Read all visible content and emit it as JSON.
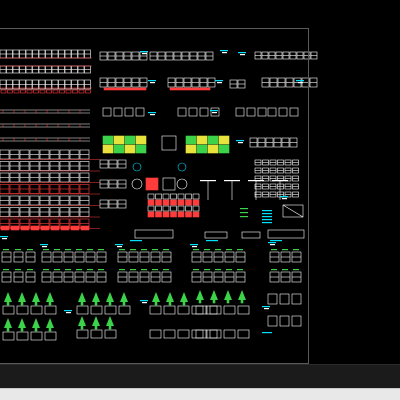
{
  "app": {
    "view": "model-space",
    "background": "#000000",
    "bottom_band": "#1b1b1b",
    "status_bar": "#e8e8e8",
    "extent_border": "#5a5a5a"
  },
  "status_bar": {
    "text": ""
  },
  "colors": {
    "white": "#ffffff",
    "red": "#ff3c3c",
    "cyan": "#00e0ff",
    "green": "#3cd24a",
    "yellow": "#e8e23c",
    "magenta": "#ff50ff",
    "grey": "#9a9a9a"
  }
}
